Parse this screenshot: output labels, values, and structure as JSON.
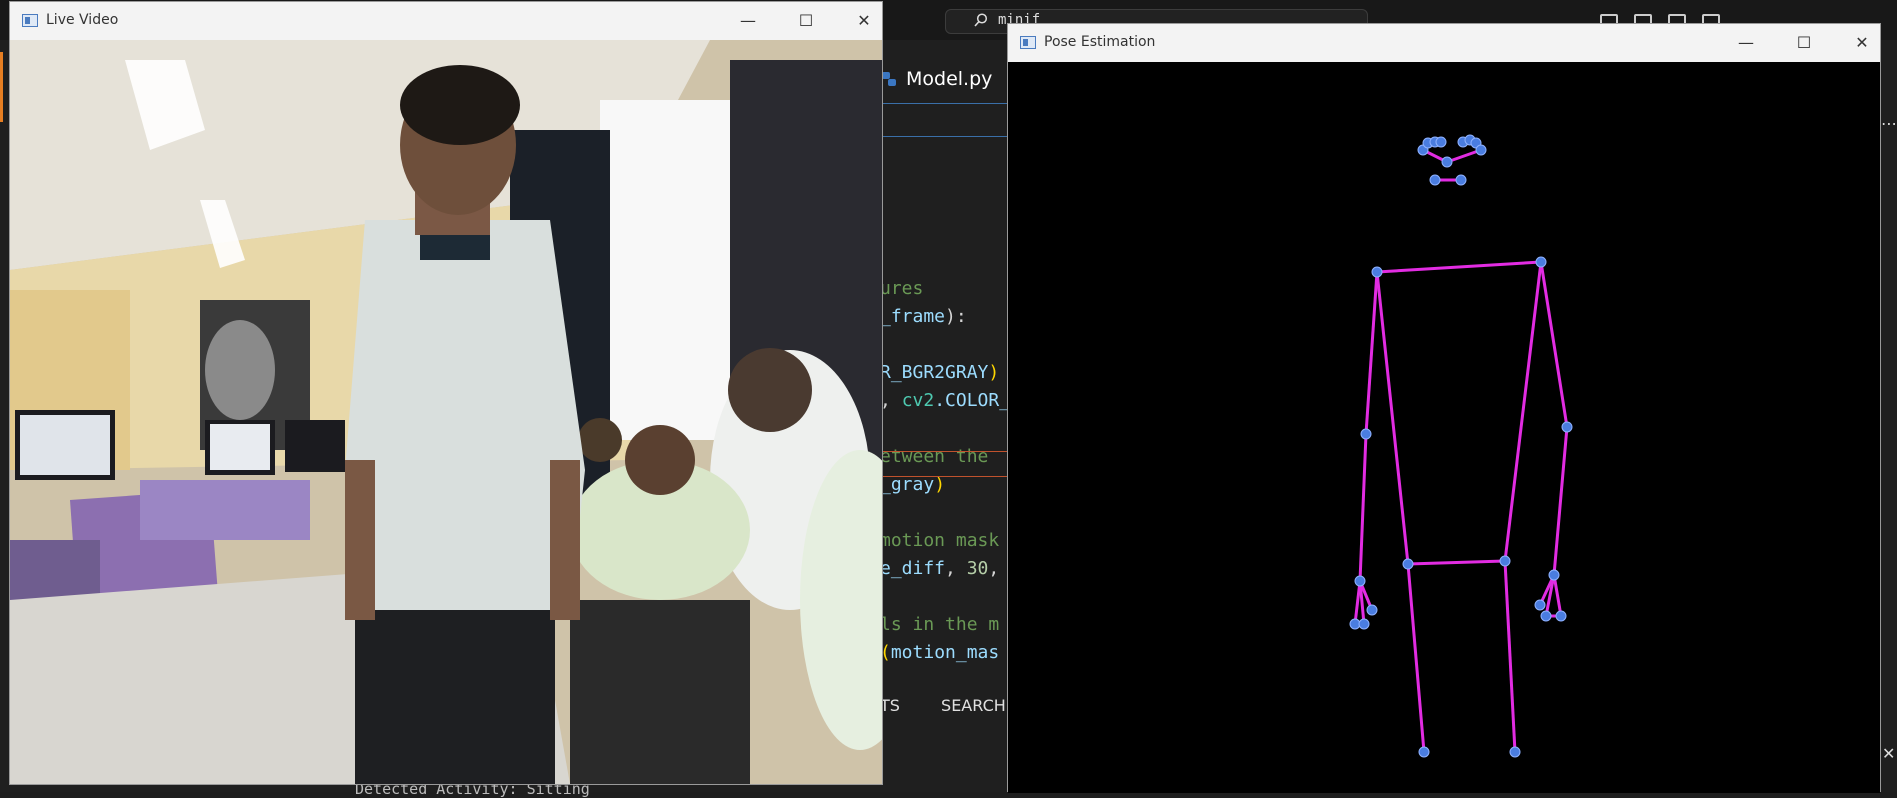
{
  "background": {
    "search_text": "minif",
    "tab_filename": "Model.py",
    "code_lines": [
      {
        "parts": [
          {
            "t": "ures",
            "c": "c-green"
          }
        ]
      },
      {
        "parts": [
          {
            "t": "_frame",
            "c": "c-blue"
          },
          {
            "t": "):",
            "c": ""
          }
        ]
      },
      {
        "parts": [
          {
            "t": "R_BGR2GRAY",
            "c": "c-blue"
          },
          {
            "t": ")",
            "c": "c-yellow"
          }
        ]
      },
      {
        "parts": [
          {
            "t": ", ",
            "c": ""
          },
          {
            "t": "cv2",
            "c": "c-teal"
          },
          {
            "t": ".COLOR_",
            "c": "c-blue"
          }
        ]
      },
      {
        "parts": [
          {
            "t": "etween the",
            "c": "c-green"
          }
        ]
      },
      {
        "parts": [
          {
            "t": "_gray",
            "c": "c-blue"
          },
          {
            "t": ")",
            "c": "c-yellow"
          }
        ]
      },
      {
        "parts": [
          {
            "t": "motion mask",
            "c": "c-green"
          }
        ]
      },
      {
        "parts": [
          {
            "t": "e_diff",
            "c": "c-blue"
          },
          {
            "t": ", ",
            "c": ""
          },
          {
            "t": "30",
            "c": "c-num"
          },
          {
            "t": ",",
            "c": ""
          }
        ]
      },
      {
        "parts": [
          {
            "t": "ls in the m",
            "c": "c-green"
          }
        ]
      },
      {
        "parts": [
          {
            "t": "(",
            "c": "c-yellow"
          },
          {
            "t": "motion_mas",
            "c": "c-blue"
          }
        ]
      }
    ],
    "panel_tabs": [
      "TS",
      "SEARCH E"
    ],
    "status_text": "Detected Activity: Sitting"
  },
  "live_window": {
    "title": "Live Video",
    "minimize": "—",
    "maximize": "☐",
    "close": "✕"
  },
  "pose_window": {
    "title": "Pose Estimation",
    "minimize": "—",
    "maximize": "☐",
    "close": "✕"
  },
  "colors": {
    "skeleton_line": "#e22ce2",
    "keypoint_fill": "#4a7de0",
    "pose_background": "#000000"
  }
}
